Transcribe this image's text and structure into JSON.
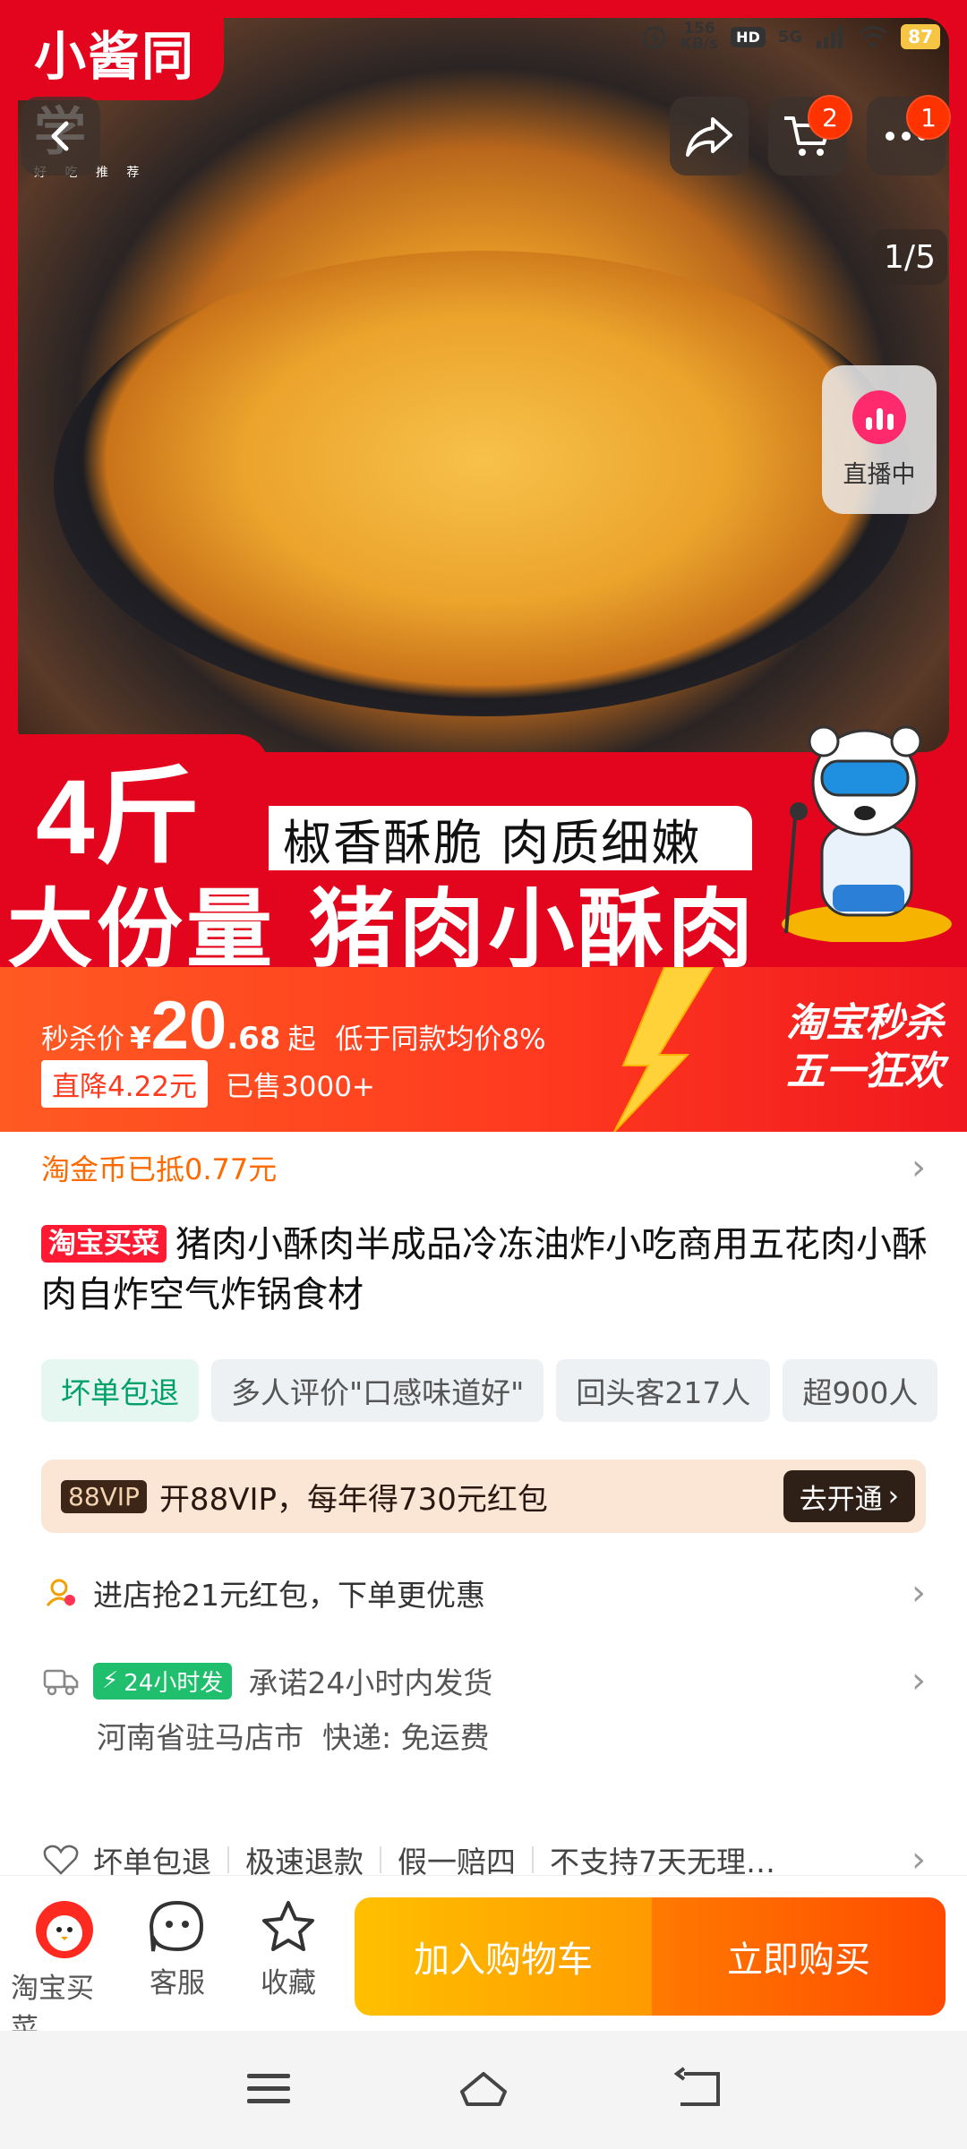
{
  "status_bar": {
    "speed_value": "156",
    "speed_unit": "KB/s",
    "hd": "HD",
    "network": "5G",
    "battery": "87"
  },
  "hero": {
    "brand": "小酱同学",
    "brand_sub": "好 吃 推 荐",
    "pager": "1/5",
    "live_label": "直播中",
    "badge_qty": "4斤",
    "slogan": "椒香酥脆 肉质细嫩",
    "headline": "大份量 猪肉小酥肉"
  },
  "toolbar": {
    "cart_count": "2",
    "more_count": "1"
  },
  "price": {
    "label": "秒杀价",
    "currency": "¥",
    "integer": "20",
    "decimal": ".68",
    "suffix": "起",
    "note": "低于同款均价8%",
    "drop": "直降4.22元",
    "sold": "已售3000+",
    "promo_line1": "淘宝秒杀",
    "promo_line2": "五一狂欢"
  },
  "coins": {
    "text": "淘金币已抵0.77元"
  },
  "product": {
    "tag": "淘宝买菜",
    "title": "猪肉小酥肉半成品冷冻油炸小吃商用五花肉小酥肉自炸空气炸锅食材"
  },
  "chips": [
    "坏单包退",
    "多人评价\"口感味道好\"",
    "回头客217人",
    "超900人"
  ],
  "vip": {
    "logo": "88VIP",
    "text": "开88VIP，每年得730元红包",
    "button": "去开通"
  },
  "store_coupon": {
    "text": "进店抢21元红包，下单更优惠"
  },
  "shipping": {
    "tag": "24小时发",
    "promise": "承诺24小时内发货",
    "origin": "河南省驻马店市",
    "courier": "快递: 免运费"
  },
  "guarantees": [
    "坏单包退",
    "极速退款",
    "假一赔四",
    "不支持7天无理…"
  ],
  "actions": {
    "store": "淘宝买菜",
    "service": "客服",
    "favorite": "收藏",
    "add_to_cart": "加入购物车",
    "buy_now": "立即购买"
  },
  "colors": {
    "brand_red": "#e3051d",
    "price_orange": "#ff3a1f",
    "cart_yellow": "#ffb000",
    "buy_orange": "#ff5a00"
  }
}
